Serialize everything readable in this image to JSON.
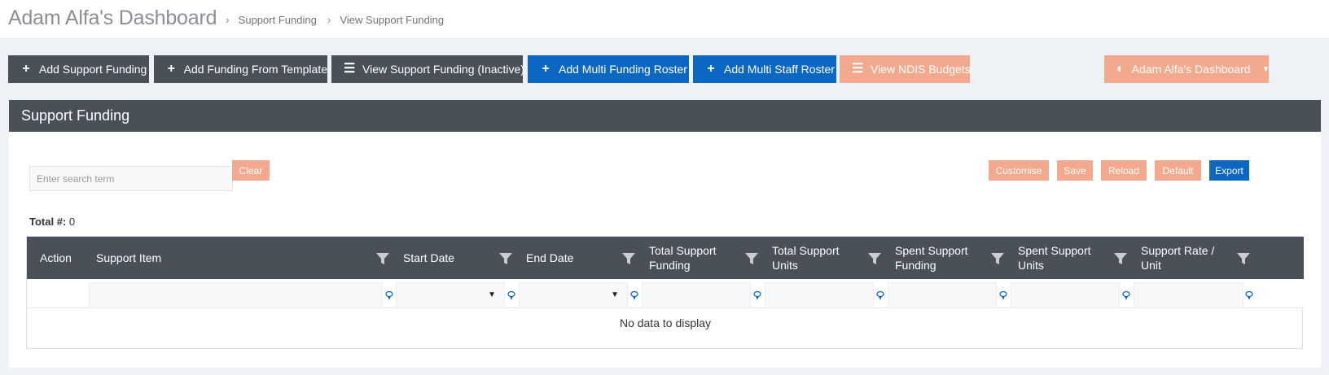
{
  "header": {
    "title": "Adam Alfa's Dashboard",
    "breadcrumbs": [
      "Support Funding",
      "View Support Funding"
    ]
  },
  "toolbar": {
    "buttons": [
      {
        "label": "Add Support Funding",
        "icon": "plus-icon",
        "style": "dark"
      },
      {
        "label": "Add Funding From Template",
        "icon": "plus-icon",
        "style": "dark"
      },
      {
        "label": "View Support Funding (Inactive)",
        "icon": "list-icon",
        "style": "dark"
      },
      {
        "label": "Add Multi Funding Roster",
        "icon": "plus-icon",
        "style": "blue"
      },
      {
        "label": "Add Multi Staff Roster",
        "icon": "plus-icon",
        "style": "blue"
      },
      {
        "label": "View NDIS Budgets",
        "icon": "list-icon",
        "style": "salmon"
      }
    ],
    "dashboard_dropdown": {
      "label": "Adam Alfa's Dashboard",
      "icon": "dashboard-icon"
    }
  },
  "panel": {
    "title": "Support Funding",
    "search_placeholder": "Enter search term",
    "clear_label": "Clear",
    "actions": {
      "customise": "Customise",
      "save": "Save",
      "reload": "Reload",
      "default": "Default",
      "export": "Export"
    },
    "total_label": "Total #:",
    "total_value": "0"
  },
  "grid": {
    "columns": [
      {
        "label": "Action",
        "filter": false
      },
      {
        "label": "Support Item",
        "filter": true
      },
      {
        "label": "Start Date",
        "filter": true
      },
      {
        "label": "End Date",
        "filter": true
      },
      {
        "label": "Total Support Funding",
        "filter": true
      },
      {
        "label": "Total Support Units",
        "filter": true
      },
      {
        "label": "Spent Support Funding",
        "filter": true
      },
      {
        "label": "Spent Support Units",
        "filter": true
      },
      {
        "label": "Support Rate / Unit",
        "filter": true
      }
    ],
    "empty_text": "No data to display"
  },
  "colors": {
    "dark": "#4a5058",
    "blue": "#0b67c2",
    "salmon": "#f2a98d",
    "background": "#eef1f5"
  }
}
